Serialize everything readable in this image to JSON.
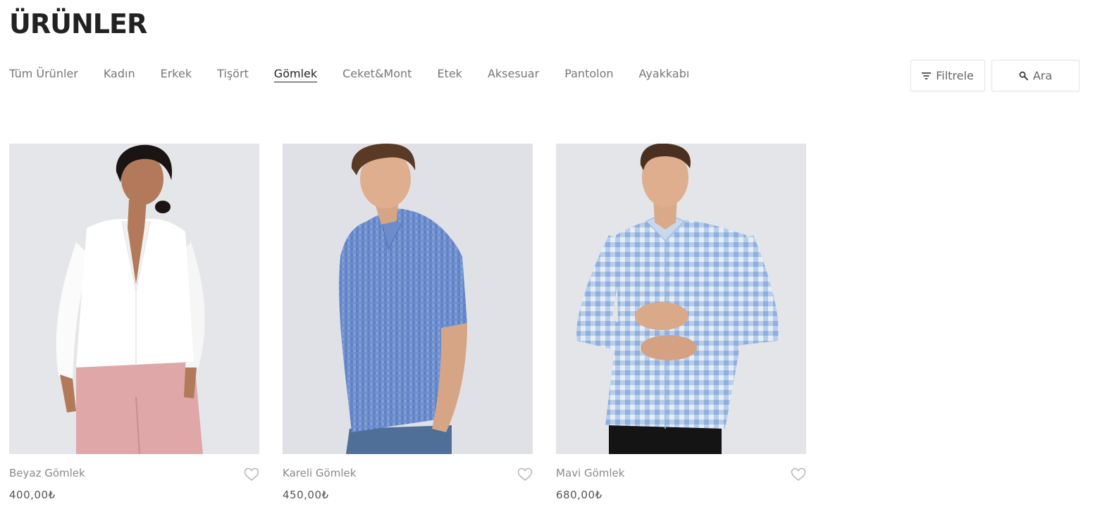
{
  "page": {
    "title": "ÜRÜNLER"
  },
  "nav": {
    "items": [
      {
        "label": "Tüm Ürünler",
        "active": false
      },
      {
        "label": "Kadın",
        "active": false
      },
      {
        "label": "Erkek",
        "active": false
      },
      {
        "label": "Tişört",
        "active": false
      },
      {
        "label": "Gömlek",
        "active": true
      },
      {
        "label": "Ceket&Mont",
        "active": false
      },
      {
        "label": "Etek",
        "active": false
      },
      {
        "label": "Aksesuar",
        "active": false
      },
      {
        "label": "Pantolon",
        "active": false
      },
      {
        "label": "Ayakkabı",
        "active": false
      }
    ]
  },
  "toolbar": {
    "filter_label": "Filtrele",
    "filter_icon": "filter-icon",
    "search_label": "Ara",
    "search_icon": "search-icon"
  },
  "products": [
    {
      "name": "Beyaz Gömlek",
      "price": "400,00₺",
      "image": "woman-in-white-shirt-photo"
    },
    {
      "name": "Kareli Gömlek",
      "price": "450,00₺",
      "image": "man-in-blue-checked-shirt-photo"
    },
    {
      "name": "Mavi Gömlek",
      "price": "680,00₺",
      "image": "man-in-light-blue-gingham-shirt-photo"
    }
  ],
  "colors": {
    "title": "#222222",
    "nav_inactive": "#777777",
    "nav_active": "#222222",
    "image_background": "#e6e7ea"
  }
}
